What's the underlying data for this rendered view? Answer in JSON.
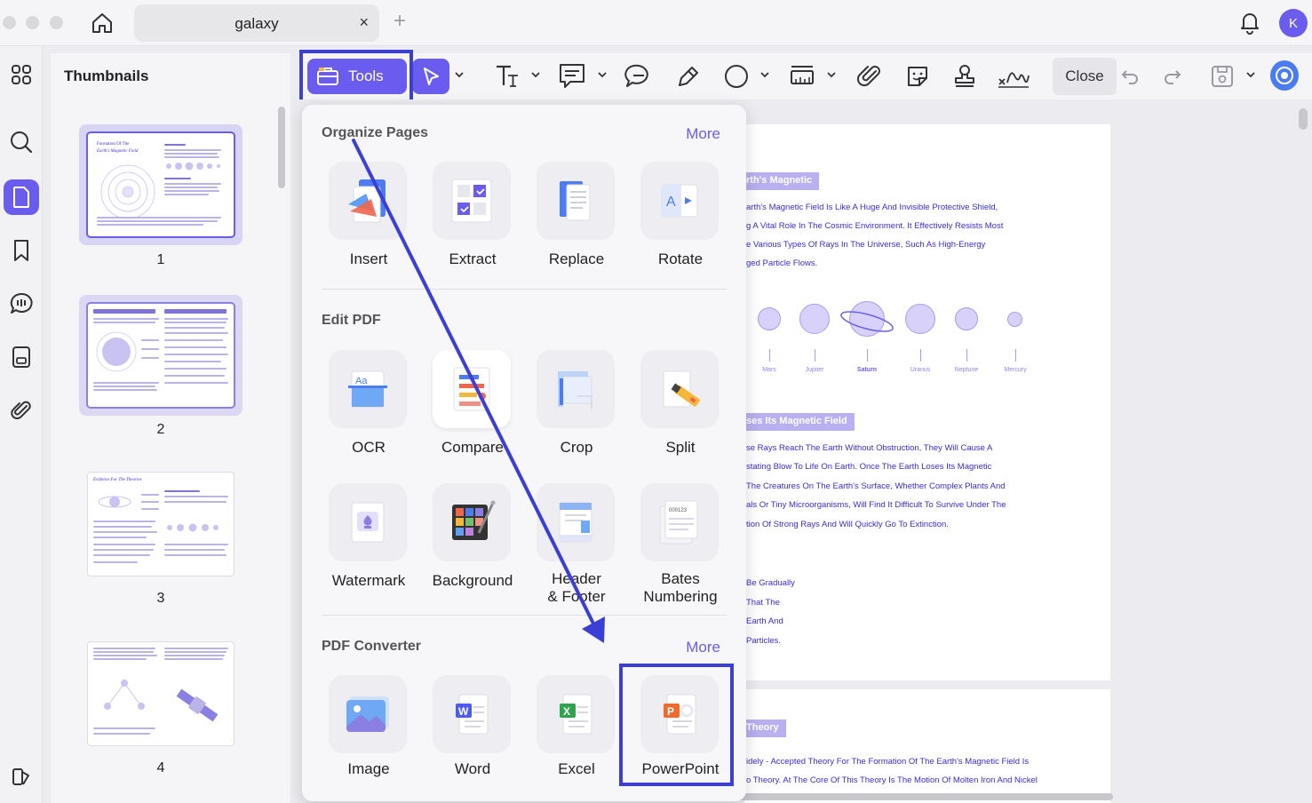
{
  "window": {
    "tab_title": "galaxy",
    "tab_close": "×",
    "tab_add": "+",
    "avatar_initial": "K"
  },
  "thumbnails": {
    "title": "Thumbnails",
    "pages": [
      "1",
      "2",
      "3",
      "4"
    ],
    "page1_title": "Formation Of The",
    "page1_subtitle": "Earth's Magnetic Field",
    "page3_title": "Evidence For The Theories"
  },
  "toolbar": {
    "tools_label": "Tools",
    "close_label": "Close"
  },
  "tools_popup": {
    "organize": {
      "title": "Organize Pages",
      "more": "More",
      "items": [
        {
          "label": "Insert",
          "icon": "insert-icon"
        },
        {
          "label": "Extract",
          "icon": "extract-icon"
        },
        {
          "label": "Replace",
          "icon": "replace-icon"
        },
        {
          "label": "Rotate",
          "icon": "rotate-icon"
        }
      ]
    },
    "edit": {
      "title": "Edit PDF",
      "items": [
        {
          "label": "OCR",
          "icon": "ocr-icon"
        },
        {
          "label": "Compare",
          "icon": "compare-icon"
        },
        {
          "label": "Crop",
          "icon": "crop-icon"
        },
        {
          "label": "Split",
          "icon": "split-icon"
        },
        {
          "label": "Watermark",
          "icon": "watermark-icon"
        },
        {
          "label": "Background",
          "icon": "background-icon"
        },
        {
          "label_line1": "Header",
          "label_line2": "& Footer",
          "icon": "header-footer-icon"
        },
        {
          "label_line1": "Bates",
          "label_line2": "Numbering",
          "icon": "bates-numbering-icon"
        }
      ]
    },
    "converter": {
      "title": "PDF Converter",
      "more": "More",
      "items": [
        {
          "label": "Image",
          "icon": "image-icon"
        },
        {
          "label": "Word",
          "icon": "word-icon"
        },
        {
          "label": "Excel",
          "icon": "excel-icon"
        },
        {
          "label": "PowerPoint",
          "icon": "powerpoint-icon"
        }
      ]
    }
  },
  "document": {
    "heading1": "rth's Magnetic",
    "para1": [
      "arth's Magnetic Field Is Like A Huge And Invisible Protective Shield,",
      "g A Vital Role In The Cosmic Environment. It Effectively Resists Most",
      "e Various Types Of Rays In The Universe, Such As High-Energy",
      "ged Particle Flows."
    ],
    "planets": [
      "Mars",
      "Jupiter",
      "Saturn",
      "Uranus",
      "Neptune",
      "Mercury"
    ],
    "heading2": "ses Its Magnetic Field",
    "para2": [
      "se Rays Reach The Earth Without Obstruction, They Will Cause A",
      "stating Blow To Life On Earth. Once The Earth Loses Its Magnetic",
      "The Creatures On The Earth's Surface, Whether Complex Plants And",
      "als Or Tiny Microorganisms, Will Find It Difficult To Survive Under The",
      "tion Of Strong Rays And Will Quickly Go To Extinction."
    ],
    "para3": [
      "Be Gradually",
      "That The",
      "Earth And",
      "Particles."
    ],
    "heading3": "Theory",
    "para4": [
      "idely - Accepted Theory For The Formation Of The Earth's Magnetic Field Is",
      "o Theory. At The Core Of This Theory Is The Motion Of Molten Iron And Nickel"
    ]
  },
  "colors": {
    "accent": "#6b5cf0",
    "highlight_box": "#3b3fd6",
    "doc_text": "#3a2cd0"
  }
}
